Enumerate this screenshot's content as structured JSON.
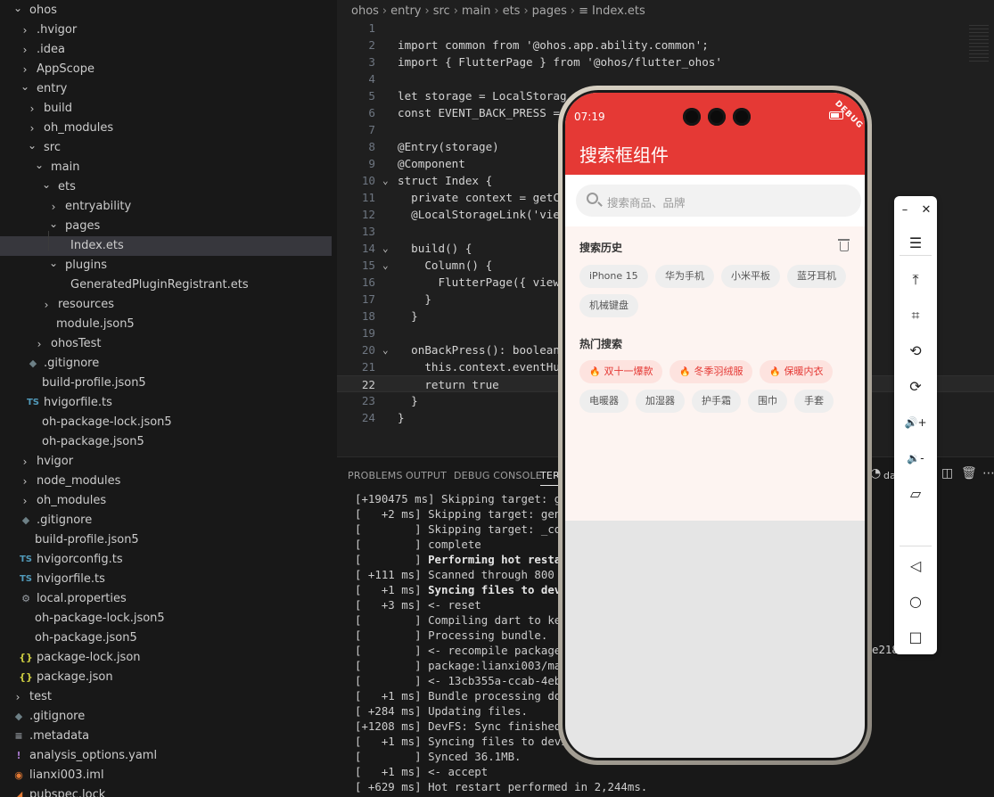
{
  "explorer": {
    "items": [
      {
        "label": "ohos",
        "depth": 0,
        "kind": "folder",
        "open": true
      },
      {
        "label": ".hvigor",
        "depth": 1,
        "kind": "folder",
        "open": false
      },
      {
        "label": ".idea",
        "depth": 1,
        "kind": "folder",
        "open": false
      },
      {
        "label": "AppScope",
        "depth": 1,
        "kind": "folder",
        "open": false
      },
      {
        "label": "entry",
        "depth": 1,
        "kind": "folder",
        "open": true
      },
      {
        "label": "build",
        "depth": 2,
        "kind": "folder",
        "open": false
      },
      {
        "label": "oh_modules",
        "depth": 2,
        "kind": "folder",
        "open": false
      },
      {
        "label": "src",
        "depth": 2,
        "kind": "folder",
        "open": true
      },
      {
        "label": "main",
        "depth": 3,
        "kind": "folder",
        "open": true
      },
      {
        "label": "ets",
        "depth": 4,
        "kind": "folder",
        "open": true
      },
      {
        "label": "entryability",
        "depth": 5,
        "kind": "folder",
        "open": false
      },
      {
        "label": "pages",
        "depth": 5,
        "kind": "folder",
        "open": true
      },
      {
        "label": "Index.ets",
        "depth": 6,
        "kind": "file",
        "selected": true
      },
      {
        "label": "plugins",
        "depth": 5,
        "kind": "folder",
        "open": true
      },
      {
        "label": "GeneratedPluginRegistrant.ets",
        "depth": 6,
        "kind": "file"
      },
      {
        "label": "resources",
        "depth": 4,
        "kind": "folder",
        "open": false
      },
      {
        "label": "module.json5",
        "depth": 4,
        "kind": "file"
      },
      {
        "label": "ohosTest",
        "depth": 3,
        "kind": "folder",
        "open": false
      },
      {
        "label": ".gitignore",
        "depth": 2,
        "kind": "file",
        "icon": "git-icon"
      },
      {
        "label": "build-profile.json5",
        "depth": 2,
        "kind": "file"
      },
      {
        "label": "hvigorfile.ts",
        "depth": 2,
        "kind": "file",
        "icon": "ts-icon"
      },
      {
        "label": "oh-package-lock.json5",
        "depth": 2,
        "kind": "file"
      },
      {
        "label": "oh-package.json5",
        "depth": 2,
        "kind": "file"
      },
      {
        "label": "hvigor",
        "depth": 1,
        "kind": "folder",
        "open": false
      },
      {
        "label": "node_modules",
        "depth": 1,
        "kind": "folder",
        "open": false
      },
      {
        "label": "oh_modules",
        "depth": 1,
        "kind": "folder",
        "open": false
      },
      {
        "label": ".gitignore",
        "depth": 1,
        "kind": "file",
        "icon": "git-icon"
      },
      {
        "label": "build-profile.json5",
        "depth": 1,
        "kind": "file"
      },
      {
        "label": "hvigorconfig.ts",
        "depth": 1,
        "kind": "file",
        "icon": "ts-icon"
      },
      {
        "label": "hvigorfile.ts",
        "depth": 1,
        "kind": "file",
        "icon": "ts-icon"
      },
      {
        "label": "local.properties",
        "depth": 1,
        "kind": "file",
        "icon": "gear-icon"
      },
      {
        "label": "oh-package-lock.json5",
        "depth": 1,
        "kind": "file"
      },
      {
        "label": "oh-package.json5",
        "depth": 1,
        "kind": "file"
      },
      {
        "label": "package-lock.json",
        "depth": 1,
        "kind": "file",
        "icon": "json-icon"
      },
      {
        "label": "package.json",
        "depth": 1,
        "kind": "file",
        "icon": "json-icon"
      },
      {
        "label": "test",
        "depth": 0,
        "kind": "folder",
        "open": false
      },
      {
        "label": ".gitignore",
        "depth": 0,
        "kind": "file",
        "icon": "git-icon"
      },
      {
        "label": ".metadata",
        "depth": 0,
        "kind": "file",
        "icon": "lines-icon"
      },
      {
        "label": "analysis_options.yaml",
        "depth": 0,
        "kind": "file",
        "icon": "exclamation-icon"
      },
      {
        "label": "lianxi003.iml",
        "depth": 0,
        "kind": "file",
        "icon": "rss-icon"
      },
      {
        "label": "pubspec.lock",
        "depth": 0,
        "kind": "file",
        "icon": "dart-icon"
      }
    ]
  },
  "editor": {
    "breadcrumb": [
      "ohos",
      "entry",
      "src",
      "main",
      "ets",
      "pages",
      "Index.ets"
    ],
    "current_line": 22,
    "lines": [
      {
        "n": "1",
        "fold": "",
        "text": ""
      },
      {
        "n": "2",
        "fold": "",
        "text": "import common from '@ohos.app.ability.common';"
      },
      {
        "n": "3",
        "fold": "",
        "text": "import { FlutterPage } from '@ohos/flutter_ohos'"
      },
      {
        "n": "4",
        "fold": "",
        "text": ""
      },
      {
        "n": "5",
        "fold": "",
        "text": "let storage = LocalStorag"
      },
      {
        "n": "6",
        "fold": "",
        "text": "const EVENT_BACK_PRESS ="
      },
      {
        "n": "7",
        "fold": "",
        "text": ""
      },
      {
        "n": "8",
        "fold": "",
        "text": "@Entry(storage)"
      },
      {
        "n": "9",
        "fold": "",
        "text": "@Component"
      },
      {
        "n": "10",
        "fold": "⌄",
        "text": "struct Index {"
      },
      {
        "n": "11",
        "fold": "",
        "text": "  private context = getC"
      },
      {
        "n": "12",
        "fold": "",
        "text": "  @LocalStorageLink('vie"
      },
      {
        "n": "13",
        "fold": "",
        "text": ""
      },
      {
        "n": "14",
        "fold": "⌄",
        "text": "  build() {"
      },
      {
        "n": "15",
        "fold": "⌄",
        "text": "    Column() {"
      },
      {
        "n": "16",
        "fold": "",
        "text": "      FlutterPage({ view"
      },
      {
        "n": "17",
        "fold": "",
        "text": "    }"
      },
      {
        "n": "18",
        "fold": "",
        "text": "  }"
      },
      {
        "n": "19",
        "fold": "",
        "text": ""
      },
      {
        "n": "20",
        "fold": "⌄",
        "text": "  onBackPress(): boolean"
      },
      {
        "n": "21",
        "fold": "",
        "text": "    this.context.eventHu"
      },
      {
        "n": "22",
        "fold": "",
        "text": "    return true"
      },
      {
        "n": "23",
        "fold": "",
        "text": "  }"
      },
      {
        "n": "24",
        "fold": "",
        "text": "}"
      }
    ]
  },
  "panel": {
    "tabs": [
      "PROBLEMS",
      "OUTPUT",
      "DEBUG CONSOLE",
      "TER"
    ],
    "active_tab": 3,
    "terminal_label": "da",
    "lines": [
      {
        "ts": "[+190475 ms]",
        "text": " Skipping target: gen",
        "bold": false
      },
      {
        "ts": "[   +2 ms]",
        "text": " Skipping target: gen_d",
        "bold": false
      },
      {
        "ts": "[        ]",
        "text": " Skipping target: _comp",
        "bold": false
      },
      {
        "ts": "[        ]",
        "text": " complete",
        "bold": false
      },
      {
        "ts": "[        ]",
        "text": " Performing hot restart",
        "bold": true
      },
      {
        "ts": "[ +111 ms]",
        "text": " Scanned through 800 fi",
        "bold": false
      },
      {
        "ts": "[   +1 ms]",
        "text": " Syncing files to devic",
        "bold": true
      },
      {
        "ts": "[   +3 ms]",
        "text": " <- reset",
        "bold": false
      },
      {
        "ts": "[        ]",
        "text": " Compiling dart to kern",
        "bold": false
      },
      {
        "ts": "[        ]",
        "text": " Processing bundle.",
        "bold": false
      },
      {
        "ts": "[        ]",
        "text": " <- recompile package:l",
        "bold": false
      },
      {
        "ts": "[        ]",
        "text": " package:lianxi003/main",
        "bold": false
      },
      {
        "ts": "[        ]",
        "text": " <- 13cb355a-ccab-4eb6-",
        "bold": false
      },
      {
        "ts": "[   +1 ms]",
        "text": " Bundle processing done",
        "bold": false
      },
      {
        "ts": "[ +284 ms]",
        "text": " Updating files.",
        "bold": false
      },
      {
        "ts": "[+1208 ms]",
        "text": " DevFS: Sync finished",
        "bold": false
      },
      {
        "ts": "[   +1 ms]",
        "text": " Syncing files to devic",
        "bold": false
      },
      {
        "ts": "[        ]",
        "text": " Synced 36.1MB.",
        "bold": false
      },
      {
        "ts": "[   +1 ms]",
        "text": " <- accept",
        "bold": false
      },
      {
        "ts": "[ +629 ms]",
        "text": " Hot restart performed in 2,244ms.",
        "bold": false
      }
    ],
    "right_fragment": "e218c"
  },
  "phone": {
    "status_time": "07:19",
    "debug_badge": "DEBUG",
    "app_title": "搜索框组件",
    "search_placeholder": "搜索商品、品牌",
    "history_title": "搜索历史",
    "history_tags": [
      "iPhone 15",
      "华为手机",
      "小米平板",
      "蓝牙耳机",
      "机械键盘"
    ],
    "hot_title": "热门搜索",
    "hot_tags": [
      {
        "label": "双十一爆款",
        "style": "hot"
      },
      {
        "label": "冬季羽绒服",
        "style": "hot"
      },
      {
        "label": "保暖内衣",
        "style": "hot-warm"
      },
      {
        "label": "电暖器",
        "style": "plain"
      },
      {
        "label": "加湿器",
        "style": "plain"
      },
      {
        "label": "护手霜",
        "style": "plain"
      },
      {
        "label": "围巾",
        "style": "plain"
      },
      {
        "label": "手套",
        "style": "plain"
      }
    ],
    "colors": {
      "appbar": "#e53935",
      "content_bg": "#fdf4f1",
      "hot_chip": "#fde3df"
    }
  },
  "emulator_toolbar": {
    "buttons": [
      {
        "name": "minimize-button",
        "glyph": "–"
      },
      {
        "name": "close-button",
        "glyph": "✕"
      },
      {
        "name": "menu-button",
        "glyph": "☰"
      },
      {
        "name": "pin-top-button",
        "glyph": "⤒"
      },
      {
        "name": "crop-screenshot-button",
        "glyph": "⌗"
      },
      {
        "name": "rotate-left-button",
        "glyph": "⟲"
      },
      {
        "name": "rotate-right-button",
        "glyph": "⟳"
      },
      {
        "name": "volume-up-button",
        "glyph": "🔊+"
      },
      {
        "name": "volume-down-button",
        "glyph": "🔉-"
      },
      {
        "name": "fold-device-button",
        "glyph": "▱"
      },
      {
        "name": "back-button",
        "glyph": "◁"
      },
      {
        "name": "home-button",
        "glyph": "○"
      },
      {
        "name": "recents-button",
        "glyph": "□"
      }
    ]
  }
}
